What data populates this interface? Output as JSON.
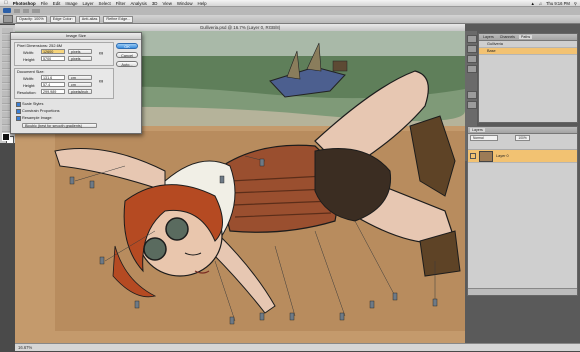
{
  "menubar": {
    "apple": "",
    "items": [
      "Photoshop",
      "File",
      "Edit",
      "Image",
      "Layer",
      "Select",
      "Filter",
      "Analysis",
      "3D",
      "View",
      "Window",
      "Help"
    ],
    "right": [
      "Thu 9:16 PM"
    ]
  },
  "options": {
    "items": [
      "Opacity: 100%",
      "Edge Color:",
      "Anti-alias",
      "Refine Edge..."
    ]
  },
  "document": {
    "title": "Gulliveria.psd @ 16.7% (Layer 0, RGB/8)"
  },
  "status": {
    "text": "16.67%"
  },
  "dialog": {
    "title": "Image Size",
    "pixel_dimensions": "Pixel Dimensions: 252.6M",
    "width_label": "Width:",
    "width_value": "12600",
    "width_unit": "pixels",
    "height_label": "Height:",
    "height_value": "5700",
    "height_unit": "pixels",
    "document_size": "Document Size:",
    "doc_width_label": "Width:",
    "doc_width_value": "131.6",
    "doc_width_unit": "cm",
    "doc_height_label": "Height:",
    "doc_height_value": "57.4",
    "doc_height_unit": "cm",
    "resolution_label": "Resolution:",
    "resolution_value": "299.989",
    "resolution_unit": "pixels/inch",
    "scale_styles": "Scale Styles",
    "constrain": "Constrain Proportions",
    "resample": "Resample Image:",
    "resample_method": "Bicubic (best for smooth gradients)",
    "ok": "OK",
    "cancel": "Cancel",
    "auto": "Auto..."
  },
  "panels": {
    "top_tabs": [
      "Layers",
      "Channels",
      "Paths"
    ],
    "top_rows": [
      "Gulliveria",
      "Base"
    ],
    "layers_tabs": [
      "Layers"
    ],
    "blend_mode": "Normal",
    "opacity": "100%",
    "layer_name": "Layer 0"
  },
  "colors": {
    "accent": "#f2c272",
    "sand": "#c49a6c",
    "sea": "#5f7f5a"
  }
}
